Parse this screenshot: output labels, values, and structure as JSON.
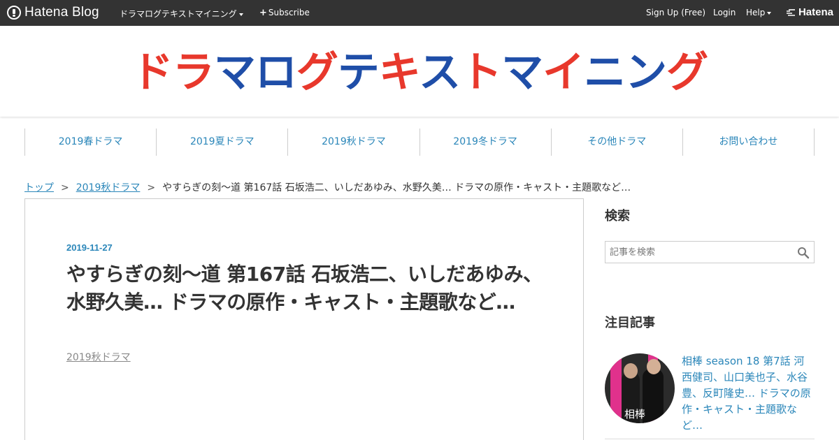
{
  "topbar": {
    "brand": "Hatena Blog",
    "blog_menu": "ドラマログテキストマイニング",
    "subscribe": "Subscribe",
    "signup": "Sign Up (Free)",
    "login": "Login",
    "help": "Help",
    "hatena": "Hatena"
  },
  "header": {
    "title_parts": [
      "ドラ",
      "マ",
      "ロ",
      "グ",
      "テ",
      "キ",
      "ス",
      "ト",
      "マ",
      "イ",
      "ニ",
      "ン",
      "グ"
    ]
  },
  "colors": {
    "accent_red": "#e8382c",
    "accent_blue": "#1f4ea8",
    "link": "#2a86b9",
    "topbar_bg": "#333333"
  },
  "categories": [
    "2019春ドラマ",
    "2019夏ドラマ",
    "2019秋ドラマ",
    "2019冬ドラマ",
    "その他ドラマ",
    "お問い合わせ"
  ],
  "breadcrumb": {
    "home": "トップ",
    "category": "2019秋ドラマ",
    "current": "やすらぎの刻～道 第167話 石坂浩二、いしだあゆみ、水野久美… ドラマの原作・キャスト・主題歌など…",
    "separator": ">"
  },
  "article": {
    "date": "2019-11-27",
    "title": "やすらぎの刻～道 第167話 石坂浩二、いしだあゆみ、水野久美… ドラマの原作・キャスト・主題歌など…",
    "category": "2019秋ドラマ"
  },
  "sidebar": {
    "search_heading": "検索",
    "search_placeholder": "記事を検索",
    "search_icon": "magnifier-icon",
    "featured_heading": "注目記事",
    "featured_thumb_text": "相棒",
    "featured_title": "相棒 season 18 第7話 河西健司、山口美也子、水谷豊、反町隆史… ドラマの原作・キャスト・主題歌など…"
  }
}
